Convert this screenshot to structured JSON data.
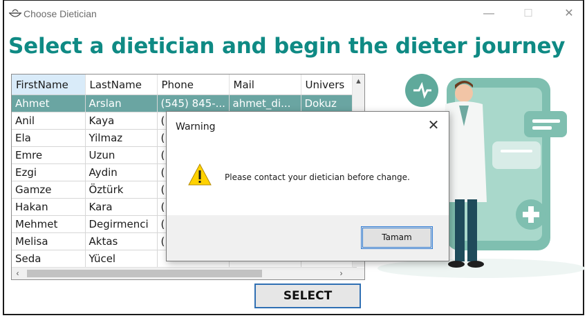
{
  "window": {
    "title": "Choose Dietician",
    "minimize": "—",
    "maximize": "☐",
    "close": "✕"
  },
  "headline": "Select a dietician and begin the dieter journey",
  "grid": {
    "columns": [
      "FirstName",
      "LastName",
      "Phone",
      "Mail",
      "Univers"
    ],
    "rows": [
      {
        "first": "Ahmet",
        "last": "Arslan",
        "phone": "(545) 845-...",
        "mail": "ahmet_di...",
        "univ": "Dokuz"
      },
      {
        "first": "Anil",
        "last": "Kaya",
        "phone": "(",
        "mail": "",
        "univ": ""
      },
      {
        "first": "Ela",
        "last": "Yilmaz",
        "phone": "(",
        "mail": "",
        "univ": ""
      },
      {
        "first": "Emre",
        "last": "Uzun",
        "phone": "(",
        "mail": "",
        "univ": ""
      },
      {
        "first": "Ezgi",
        "last": "Aydin",
        "phone": "(",
        "mail": "",
        "univ": ""
      },
      {
        "first": "Gamze",
        "last": "Öztürk",
        "phone": "(",
        "mail": "",
        "univ": ""
      },
      {
        "first": "Hakan",
        "last": "Kara",
        "phone": "(",
        "mail": "",
        "univ": ""
      },
      {
        "first": "Mehmet",
        "last": "Degirmenci",
        "phone": "(",
        "mail": "",
        "univ": ""
      },
      {
        "first": "Melisa",
        "last": "Aktas",
        "phone": "(",
        "mail": "",
        "univ": ""
      },
      {
        "first": "Seda",
        "last": "Yücel",
        "phone": "",
        "mail": "",
        "univ": ""
      }
    ],
    "selected_row": 0
  },
  "select_button": "SELECT",
  "dialog": {
    "title": "Warning",
    "close": "✕",
    "message": "Please contact your dietician before change.",
    "ok_button": "Tamam"
  },
  "colors": {
    "accent": "#0f8a84",
    "selected_row": "#6aa5a2",
    "illustration_teal": "#6fb5a5"
  },
  "icons": [
    "app-bowl-icon",
    "warning-icon",
    "heart-pulse-icon",
    "plus-icon"
  ]
}
